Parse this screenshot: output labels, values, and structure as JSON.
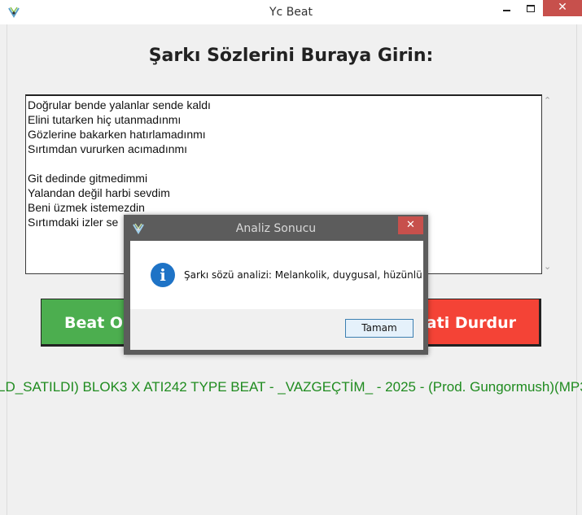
{
  "window": {
    "title": "Yc Beat",
    "minimize_icon": "minimize-icon",
    "maximize_icon": "maximize-icon",
    "close_label": "✕"
  },
  "main": {
    "heading": "Şarkı Sözlerini Buraya Girin:",
    "lyrics": [
      "Doğrular bende yalanlar sende kaldı",
      "Elini tutarken hiç utanmadınmı",
      "Gözlerine bakarken hatırlamadınmı",
      "Sırtımdan vururken acımadınmı",
      "",
      "Git dedinde gitmedimmi",
      "Yalandan değil harbi sevdim",
      "Beni üzmek istemezdin",
      "Sırtımdaki izler se"
    ],
    "generate_button": "Beat Ol",
    "stop_button": "Beati Durdur",
    "now_playing": "LD_SATILDI) BLOK3 X ATI242 TYPE BEAT - _VAZGEÇTİM_ - 2025 - (Prod. Gungormush)(MP3"
  },
  "dialog": {
    "title": "Analiz Sonucu",
    "close_label": "✕",
    "message": "Şarkı sözü analizi: Melankolik, duygusal, hüzünlü",
    "info_icon": "i",
    "ok_button": "Tamam"
  },
  "colors": {
    "green_button": "#4cae4f",
    "red_button": "#f44336",
    "marquee_text": "#1f8b1f",
    "close_button": "#c7504c"
  }
}
